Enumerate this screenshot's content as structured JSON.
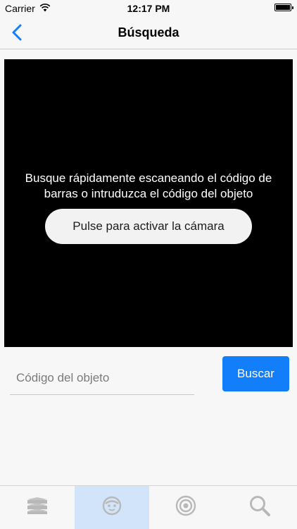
{
  "status_bar": {
    "carrier": "Carrier",
    "time": "12:17 PM",
    "wifi_icon": "wifi-icon",
    "battery_icon": "battery-icon"
  },
  "nav": {
    "title": "Búsqueda",
    "back_icon": "chevron-left-icon"
  },
  "camera": {
    "message_line1": "Busque rápidamente escaneando el código de",
    "message_line2": "barras o intruduzca el código del objeto",
    "activate_label": "Pulse para activar la cámara"
  },
  "search": {
    "placeholder": "Código del objeto",
    "value": "",
    "button_label": "Buscar"
  },
  "tabs": [
    {
      "icon": "books-stack-icon",
      "selected": false
    },
    {
      "icon": "face-icon",
      "selected": true
    },
    {
      "icon": "target-icon",
      "selected": false
    },
    {
      "icon": "magnifier-icon",
      "selected": false
    }
  ],
  "colors": {
    "accent": "#127ef9",
    "selected_tab_bg": "#d2e4f9",
    "inactive_icon": "#b8b8b8",
    "camera_bg": "#000000"
  }
}
